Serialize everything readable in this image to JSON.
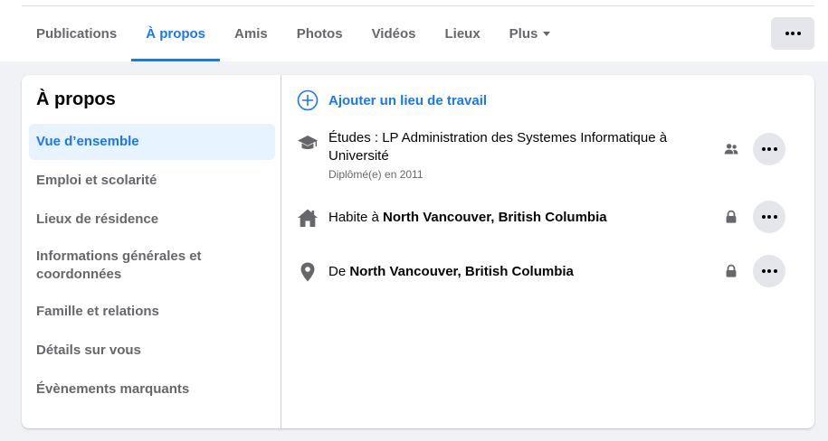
{
  "tabs": [
    {
      "label": "Publications",
      "active": false
    },
    {
      "label": "À propos",
      "active": true
    },
    {
      "label": "Amis",
      "active": false
    },
    {
      "label": "Photos",
      "active": false
    },
    {
      "label": "Vidéos",
      "active": false
    },
    {
      "label": "Lieux",
      "active": false
    },
    {
      "label": "Plus",
      "active": false
    }
  ],
  "card": {
    "title": "À propos",
    "nav": [
      "Vue d’ensemble",
      "Emploi et scolarité",
      "Lieux de résidence",
      "Informations générales et coordonnées",
      "Famille et relations",
      "Détails sur vous",
      "Évènements marquants"
    ]
  },
  "overview": {
    "add_workplace": "Ajouter un lieu de travail",
    "education": {
      "prefix": "Études : LP Administration des Systemes Informatique à Université",
      "sub": "Diplômé(e) en 2011",
      "privacy_icon": "friends-icon"
    },
    "lives": {
      "prefix": "Habite à ",
      "place": "North Vancouver, British Columbia",
      "privacy_icon": "lock-icon"
    },
    "from": {
      "prefix": "De ",
      "place": "North Vancouver, British Columbia",
      "privacy_icon": "lock-icon"
    }
  },
  "colors": {
    "accent": "#1877f2",
    "secondary_text": "#65676b",
    "button_bg": "#e4e6eb",
    "page_bg": "#f0f2f5",
    "active_nav_bg": "#e7f3ff"
  }
}
